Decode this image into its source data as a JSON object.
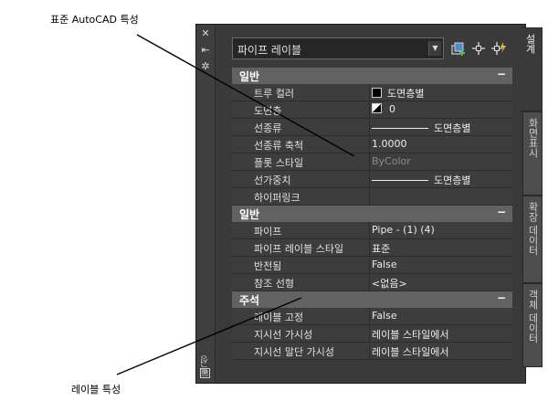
{
  "callouts": {
    "top": "표준 AutoCAD 특성",
    "bottom": "레이블 특성"
  },
  "titlebar": {
    "close_glyph": "✕",
    "autohide_glyph": "⇤",
    "properties_glyph": "✲",
    "title": "특성",
    "bottom_glyph": "回"
  },
  "selector": {
    "value": "파이프 레이블",
    "arrow": "▼"
  },
  "tools": [
    "add-selection-icon",
    "select-objects-icon",
    "quick-select-icon"
  ],
  "categories": [
    {
      "label": "일반",
      "toggle": "−",
      "rows": [
        {
          "label": "트루 컬러",
          "value": "도면층별",
          "mark": "swatch"
        },
        {
          "label": "도면층",
          "value": "0",
          "mark": "tri"
        },
        {
          "label": "선종류",
          "value": "도면층별",
          "mark": "line"
        },
        {
          "label": "선종류 축척",
          "value": "1.0000"
        },
        {
          "label": "플롯 스타일",
          "value": "ByColor",
          "dim": true
        },
        {
          "label": "선가중치",
          "value": "도면층별",
          "mark": "line"
        },
        {
          "label": "하이퍼링크",
          "value": ""
        }
      ]
    },
    {
      "label": "일반",
      "toggle": "−",
      "rows": [
        {
          "label": "파이프",
          "value": "Pipe - (1) (4)"
        },
        {
          "label": "파이프 레이블 스타일",
          "value": "표준"
        },
        {
          "label": "반전됨",
          "value": "False"
        },
        {
          "label": "참조 선형",
          "value": "<없음>"
        }
      ]
    },
    {
      "label": "주석",
      "toggle": "−",
      "rows": [
        {
          "label": "레이블 고정",
          "value": "False"
        },
        {
          "label": "지시선 가시성",
          "value": "레이블 스타일에서"
        },
        {
          "label": "지시선 말단 가시성",
          "value": "레이블 스타일에서"
        }
      ]
    }
  ],
  "tabs": [
    {
      "label": "설계",
      "active": true
    },
    {
      "label": "화면표시",
      "active": false
    },
    {
      "label": "확장 데이터",
      "active": false
    },
    {
      "label": "객체 데이터",
      "active": false
    }
  ]
}
